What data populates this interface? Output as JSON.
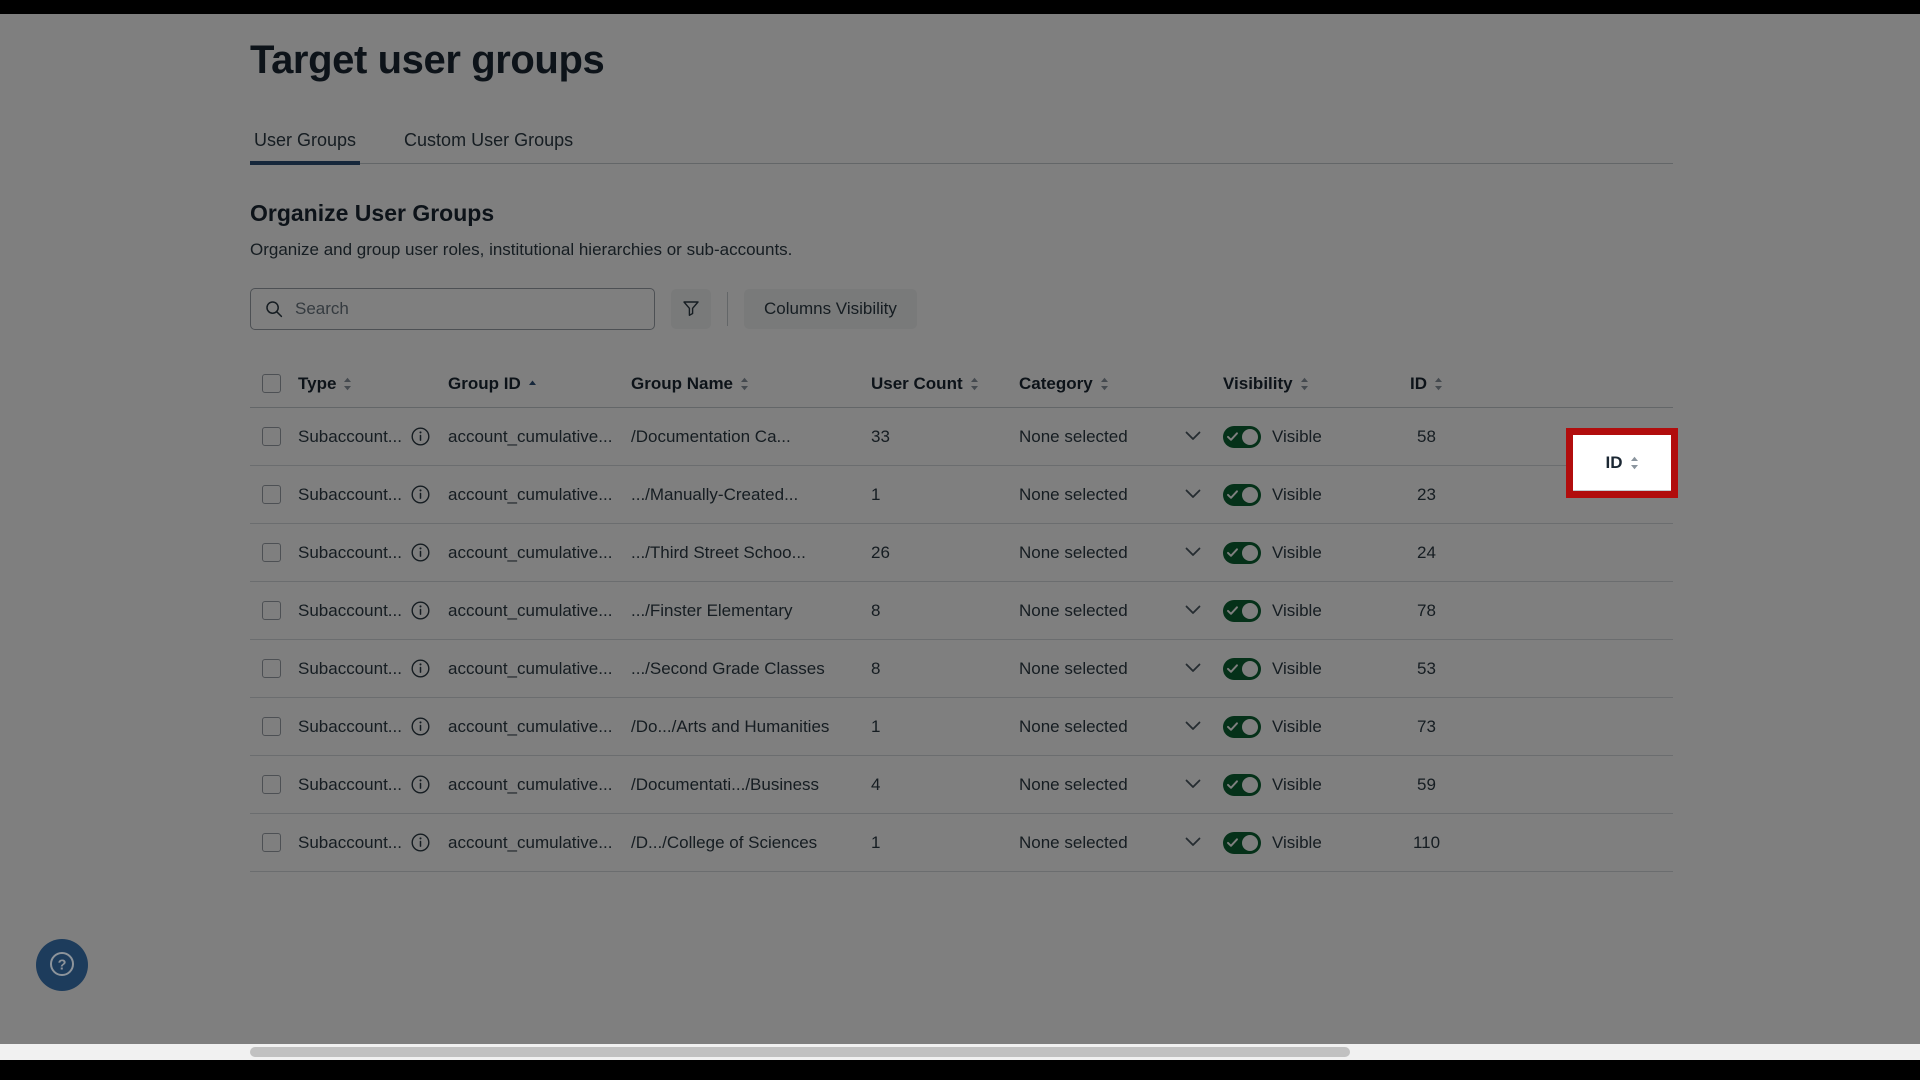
{
  "page": {
    "title": "Target user groups"
  },
  "tabs": [
    {
      "label": "User Groups",
      "active": true
    },
    {
      "label": "Custom User Groups",
      "active": false
    }
  ],
  "section": {
    "title": "Organize User Groups",
    "subtitle": "Organize and group user roles, institutional hierarchies or sub-accounts."
  },
  "toolbar": {
    "search_placeholder": "Search",
    "search_value": "",
    "search_icon": "search-icon",
    "filter_icon": "filter-funnel-icon",
    "columns_label": "Columns Visibility"
  },
  "table": {
    "columns": [
      {
        "key": "select",
        "label": "",
        "sort": "none"
      },
      {
        "key": "type",
        "label": "Type",
        "sort": "none"
      },
      {
        "key": "group_id",
        "label": "Group ID",
        "sort": "asc"
      },
      {
        "key": "group_name",
        "label": "Group Name",
        "sort": "none"
      },
      {
        "key": "user_count",
        "label": "User Count",
        "sort": "none"
      },
      {
        "key": "category",
        "label": "Category",
        "sort": "none"
      },
      {
        "key": "visibility",
        "label": "Visibility",
        "sort": "none"
      },
      {
        "key": "id",
        "label": "ID",
        "sort": "none"
      }
    ],
    "rows": [
      {
        "type": "Subaccount...",
        "group_id": "account_cumulative...",
        "group_name": "/Documentation Ca...",
        "user_count": "33",
        "category": "None selected",
        "visibility": "Visible",
        "visible": true,
        "id": "58"
      },
      {
        "type": "Subaccount...",
        "group_id": "account_cumulative...",
        "group_name": ".../Manually-Created...",
        "user_count": "1",
        "category": "None selected",
        "visibility": "Visible",
        "visible": true,
        "id": "23"
      },
      {
        "type": "Subaccount...",
        "group_id": "account_cumulative...",
        "group_name": ".../Third Street Schoo...",
        "user_count": "26",
        "category": "None selected",
        "visibility": "Visible",
        "visible": true,
        "id": "24"
      },
      {
        "type": "Subaccount...",
        "group_id": "account_cumulative...",
        "group_name": ".../Finster Elementary",
        "user_count": "8",
        "category": "None selected",
        "visibility": "Visible",
        "visible": true,
        "id": "78"
      },
      {
        "type": "Subaccount...",
        "group_id": "account_cumulative...",
        "group_name": ".../Second Grade Classes",
        "user_count": "8",
        "category": "None selected",
        "visibility": "Visible",
        "visible": true,
        "id": "53"
      },
      {
        "type": "Subaccount...",
        "group_id": "account_cumulative...",
        "group_name": "/Do.../Arts and Humanities",
        "user_count": "1",
        "category": "None selected",
        "visibility": "Visible",
        "visible": true,
        "id": "73"
      },
      {
        "type": "Subaccount...",
        "group_id": "account_cumulative...",
        "group_name": "/Documentati.../Business",
        "user_count": "4",
        "category": "None selected",
        "visibility": "Visible",
        "visible": true,
        "id": "59"
      },
      {
        "type": "Subaccount...",
        "group_id": "account_cumulative...",
        "group_name": "/D.../College of Sciences",
        "user_count": "1",
        "category": "None selected",
        "visibility": "Visible",
        "visible": true,
        "id": "110"
      }
    ]
  },
  "help": {
    "icon": "question-mark-icon",
    "label": "?"
  },
  "highlight": {
    "target_label": "ID",
    "border_color": "#b10d0d"
  },
  "colors": {
    "accent": "#2d4f76",
    "toggle_on": "#0b6333",
    "text": "#2d3b45",
    "heading": "#1b2733",
    "highlight": "#b10d0d",
    "help_fab": "#1d3c5c"
  }
}
